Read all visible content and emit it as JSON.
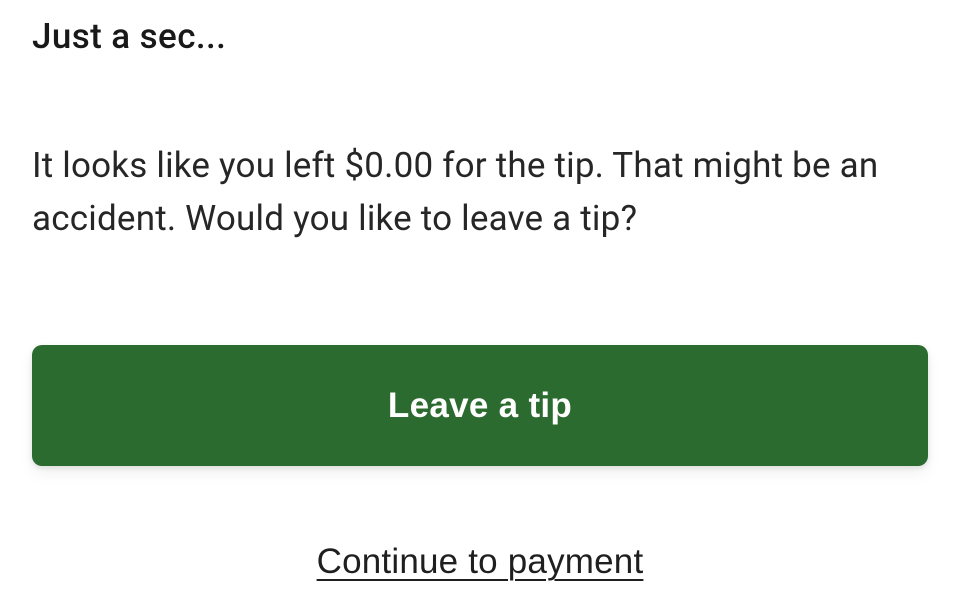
{
  "dialog": {
    "title": "Just a sec...",
    "message": "It looks like you left $0.00 for the tip. That might be an accident. Would you like to leave a tip?",
    "primary_label": "Leave a tip",
    "secondary_label": "Continue to payment"
  },
  "colors": {
    "primary": "#2b6b2f"
  }
}
